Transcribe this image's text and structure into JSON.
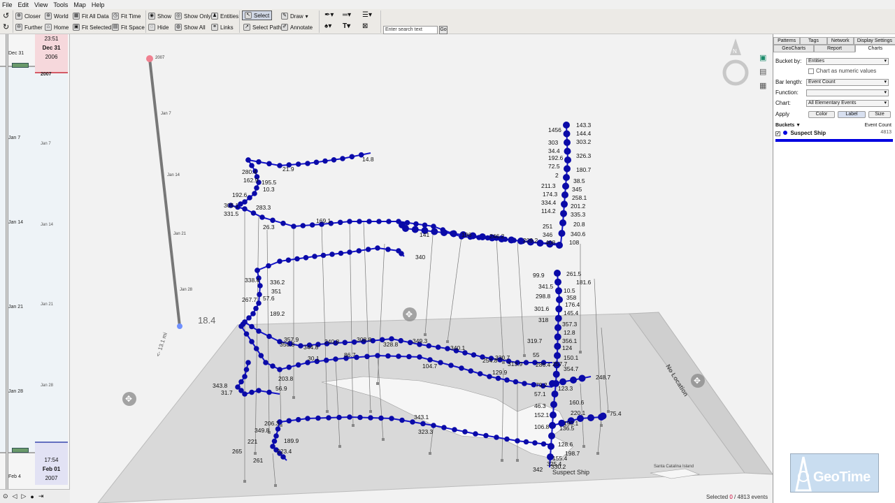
{
  "menu": [
    "File",
    "Edit",
    "View",
    "Tools",
    "Map",
    "Help"
  ],
  "toolbar": {
    "row1": [
      {
        "id": "closer",
        "label": "Closer",
        "icon": "closer-icon",
        "glyph": "⊕"
      },
      {
        "id": "world",
        "label": "World",
        "icon": "world-icon",
        "glyph": "⊛"
      },
      {
        "id": "fit_all",
        "label": "Fit All Data",
        "icon": "fit-all-icon",
        "glyph": "▦"
      },
      {
        "id": "fit_time",
        "label": "Fit Time",
        "icon": "fit-time-icon",
        "glyph": "◷"
      },
      {
        "id": "show",
        "label": "Show",
        "icon": "show-icon",
        "glyph": "◉"
      },
      {
        "id": "show_only",
        "label": "Show Only",
        "icon": "show-only-icon",
        "glyph": "◎"
      },
      {
        "id": "entities",
        "label": "Entities",
        "icon": "entities-icon",
        "glyph": "♟"
      },
      {
        "id": "select",
        "label": "Select",
        "icon": "select-icon",
        "glyph": "↖"
      },
      {
        "id": "draw",
        "label": "Draw",
        "icon": "draw-icon",
        "glyph": "✎"
      }
    ],
    "row2": [
      {
        "id": "further",
        "label": "Further",
        "icon": "further-icon",
        "glyph": "⊖"
      },
      {
        "id": "home",
        "label": "Home",
        "icon": "home-icon",
        "glyph": "⌂"
      },
      {
        "id": "fit_selected",
        "label": "Fit Selected",
        "icon": "fit-selected-icon",
        "glyph": "▣"
      },
      {
        "id": "fit_space",
        "label": "Fit Space",
        "icon": "fit-space-icon",
        "glyph": "▤"
      },
      {
        "id": "hide",
        "label": "Hide",
        "icon": "hide-icon",
        "glyph": "◌"
      },
      {
        "id": "show_all",
        "label": "Show All",
        "icon": "show-all-icon",
        "glyph": "◍"
      },
      {
        "id": "links",
        "label": "Links",
        "icon": "links-icon",
        "glyph": "⚭"
      },
      {
        "id": "select_path",
        "label": "Select Path",
        "icon": "select-path-icon",
        "glyph": "↗"
      },
      {
        "id": "annotate",
        "label": "Annotate",
        "icon": "annotate-icon",
        "glyph": "✐"
      }
    ],
    "search_placeholder": "Enter search text",
    "go_label": "Go"
  },
  "timeline": {
    "start_time": "23:51",
    "start_date": "Dec 31",
    "start_year": "2006",
    "start_left_label": "Dec 31",
    "start_sub": "2007",
    "end_time": "17:54",
    "end_date": "Feb 01",
    "end_year": "2007",
    "labels": [
      "Jan 7",
      "Jan 14",
      "Jan 21",
      "Jan 28",
      "Feb 4"
    ],
    "minor_labels": [
      "Jan 7",
      "Jan 14",
      "Jan 21",
      "Jan 28"
    ]
  },
  "view": {
    "axis_top_label": "2007",
    "axis_labels": [
      "Jan 7",
      "Jan 14",
      "Jan 21",
      "Jan 28"
    ],
    "scale_value": "18.4",
    "scale_unit": "<- 13.1 mi",
    "no_location": "No Location",
    "island_label": "Santa Catalina Island",
    "entity_label": "Suspect Ship",
    "compass_label": "N",
    "path_color": "#1515c8",
    "point_color": "#0a0aa8",
    "value_labels": [
      "143.3",
      "144.4",
      "303.2",
      "326.3",
      "180.7",
      "38.5",
      "345",
      "258.1",
      "201.2",
      "335.3",
      "20.8",
      "340.6",
      "108",
      "1456",
      "303",
      "34.4",
      "192.6",
      "72.5",
      "2",
      "211.3",
      "174.3",
      "334.4",
      "114.2",
      "251",
      "346",
      "408",
      "261.5",
      "181.6",
      "10.5",
      "358",
      "176.4",
      "145.4",
      "357.3",
      "12.8",
      "356.1",
      "124",
      "150.1",
      "354.7",
      "99.9",
      "341.5",
      "298.8",
      "301.6",
      "318",
      "319.7",
      "55",
      "286.4",
      "257.7",
      "14.8",
      "21.9",
      "280.4",
      "162.9",
      "195.5",
      "192.6",
      "10.3",
      "283.3",
      "305.1",
      "331.5",
      "26.3",
      "169.1",
      "141",
      "196",
      "246.2",
      "209.2",
      "340",
      "338.4",
      "336.2",
      "351",
      "57.6",
      "267.7",
      "189.2",
      "357.9",
      "344.8",
      "350.8",
      "240.8",
      "308.8",
      "328.8",
      "349.3",
      "340.1",
      "330.7",
      "254.8",
      "313.9",
      "129.9",
      "30.1",
      "86.7",
      "104.7",
      "203.8",
      "343.8",
      "31.7",
      "56.9",
      "79.2",
      "57.1",
      "123.3",
      "46.3",
      "160.6",
      "220.1",
      "248.7",
      "152.1",
      "190.1",
      "75.4",
      "106.8",
      "136.5",
      "128.6",
      "198.7",
      "155.4",
      "330.2",
      "325.4",
      "342",
      "206.3",
      "349.8",
      "189.9",
      "221",
      "265",
      "261",
      "223.4",
      "343.1",
      "323.3"
    ]
  },
  "panel": {
    "tabs_top": [
      "Patterns",
      "Tags",
      "Network",
      "Display Settings"
    ],
    "tabs_bottom": [
      "GeoCharts",
      "Report",
      "Charts"
    ],
    "bucket_by_label": "Bucket by:",
    "bucket_by_value": "Entities",
    "numeric_label": "Chart as numeric values",
    "bar_length_label": "Bar length:",
    "bar_length_value": "Event Count",
    "function_label": "Function:",
    "function_value": "",
    "chart_label": "Chart:",
    "chart_value": "All Elementary Events",
    "apply_label": "Apply",
    "color_btn": "Color",
    "label_btn": "Label",
    "size_btn": "Size",
    "buckets_header": "Buckets",
    "event_count_header": "Event Count",
    "bucket_name": "Suspect Ship",
    "bucket_count": "4813",
    "bucket_color": "#0000e0"
  },
  "status": {
    "selected_label": "Selected",
    "selected_count": "0",
    "total": "4813",
    "events_word": "events"
  },
  "logo_text": "GeoTime"
}
